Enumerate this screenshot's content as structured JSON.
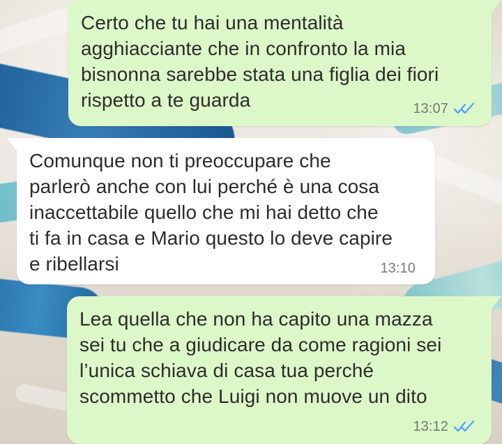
{
  "messages": [
    {
      "direction": "outgoing",
      "text": "Certo che tu hai una mentalità\nagghiacciante che in confronto la mia\nbisnonna sarebbe stata una figlia dei fiori\nrispetto a te guarda",
      "time": "13:07",
      "status_icon": "double-check-read-icon"
    },
    {
      "direction": "incoming",
      "text": "Comunque non ti preoccupare che\nparlerò anche con lui perché è una cosa\ninaccettabile quello che mi hai detto che\nti fa in casa e Mario questo lo deve capire\ne ribellarsi",
      "time": "13:10"
    },
    {
      "direction": "outgoing",
      "text": "Lea quella che non ha capito una mazza\nsei tu che a giudicare da come ragioni sei\nl’unica schiava di casa tua perché\nscommetto che Luigi non muove un dito",
      "time": "13:12",
      "status_icon": "double-check-read-icon"
    }
  ],
  "colors": {
    "outgoing_bubble": "#ddf8c8",
    "incoming_bubble": "#ffffff",
    "read_check": "#4ea4ff"
  }
}
